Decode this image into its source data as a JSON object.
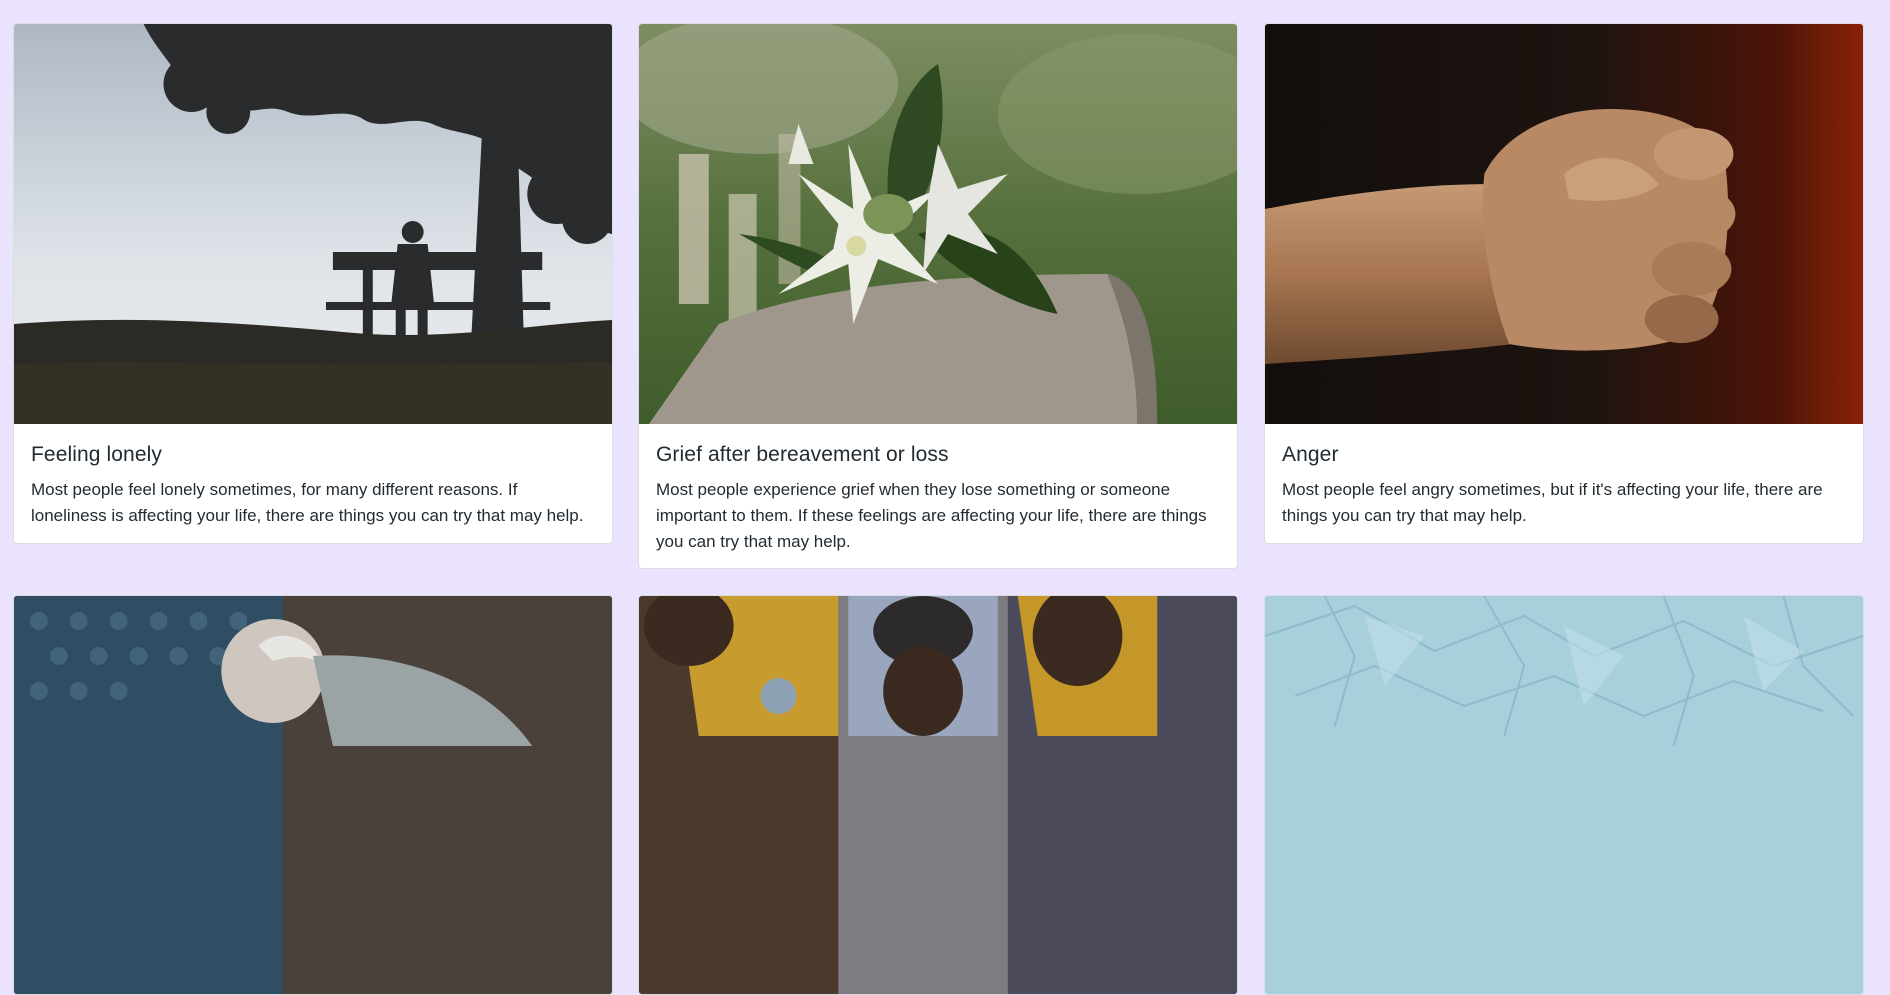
{
  "cards": [
    {
      "title": "Feeling lonely",
      "description": "Most people feel lonely sometimes, for many different reasons. If loneliness is affecting your life, there are things you can try that may help.",
      "image": "person-on-bench-under-tree"
    },
    {
      "title": "Grief after bereavement or loss",
      "description": "Most people experience grief when they lose something or someone important to them. If these feelings are affecting your life, there are things you can try that may help.",
      "image": "lilies-on-gravestone"
    },
    {
      "title": "Anger",
      "description": "Most people feel angry sometimes, but if it's affecting your life, there are things you can try that may help.",
      "image": "clenched-fist"
    },
    {
      "title": "",
      "description": "",
      "image": "older-man-leaning-forward"
    },
    {
      "title": "",
      "description": "",
      "image": "young-man-multiple-exposure"
    },
    {
      "title": "",
      "description": "",
      "image": "crumpled-blue-paper"
    }
  ],
  "colors": {
    "page_background": "#ebe3fd",
    "card_background": "#ffffff",
    "text": "#212b32",
    "card_border": "#d8dde0"
  }
}
